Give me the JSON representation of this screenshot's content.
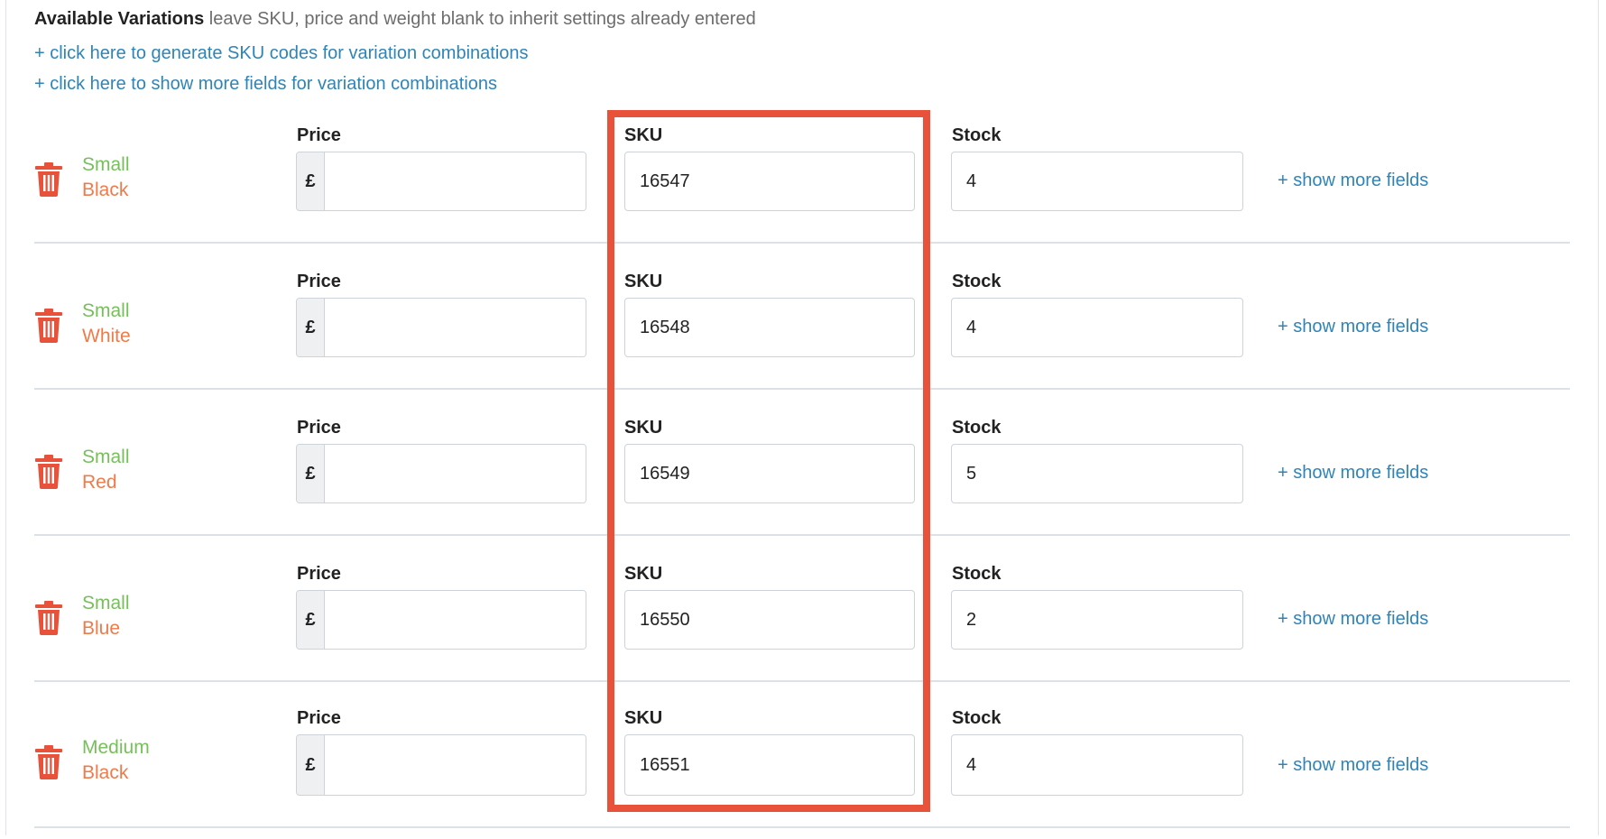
{
  "header": {
    "title": "Available Variations",
    "hint": "leave SKU, price and weight blank to inherit settings already entered"
  },
  "links": {
    "generate_sku": "+ click here to generate SKU codes for variation combinations",
    "show_more_all": "+ click here to show more fields for variation combinations"
  },
  "labels": {
    "price": "Price",
    "sku": "SKU",
    "stock": "Stock",
    "currency": "£",
    "show_more": "+ show more fields"
  },
  "variations": [
    {
      "size": "Small",
      "color": "Black",
      "price": "",
      "sku": "16547",
      "stock": "4"
    },
    {
      "size": "Small",
      "color": "White",
      "price": "",
      "sku": "16548",
      "stock": "4"
    },
    {
      "size": "Small",
      "color": "Red",
      "price": "",
      "sku": "16549",
      "stock": "5"
    },
    {
      "size": "Small",
      "color": "Blue",
      "price": "",
      "sku": "16550",
      "stock": "2"
    },
    {
      "size": "Medium",
      "color": "Black",
      "price": "",
      "sku": "16551",
      "stock": "4"
    }
  ],
  "colors": {
    "size_text": "#76c05a",
    "color_text": "#ef7a4a",
    "link": "#2f84b7",
    "trash_icon": "#e8513a",
    "highlight_border": "#e8513a"
  }
}
